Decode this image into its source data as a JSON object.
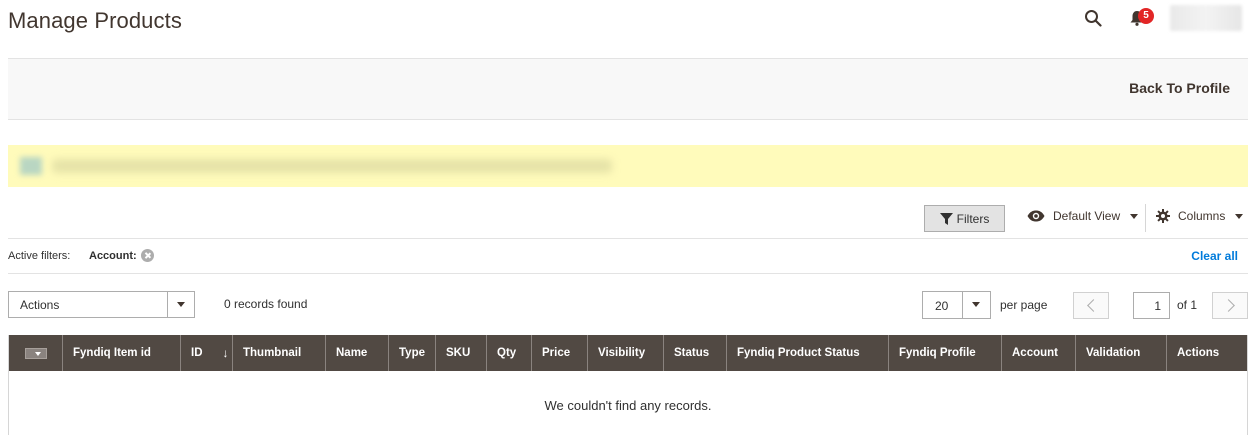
{
  "header": {
    "title": "Manage Products",
    "notifications_count": "5",
    "search_icon": "search-icon",
    "bell_icon": "bell-icon"
  },
  "actions_bar": {
    "back_label": "Back To Profile"
  },
  "toolbar": {
    "filters_label": "Filters",
    "view_label": "Default View",
    "columns_label": "Columns"
  },
  "active_filters": {
    "label": "Active filters:",
    "items": [
      "Account:"
    ],
    "clear_all": "Clear all"
  },
  "mass_actions": {
    "select_label": "Actions",
    "records_found": "0 records found"
  },
  "pagination": {
    "per_page_value": "20",
    "per_page_label": "per page",
    "current_page": "1",
    "of_label": "of 1"
  },
  "grid": {
    "columns": [
      "Fyndiq Item id",
      "ID",
      "Thumbnail",
      "Name",
      "Type",
      "SKU",
      "Qty",
      "Price",
      "Visibility",
      "Status",
      "Fyndiq Product Status",
      "Fyndiq Profile",
      "Account",
      "Validation",
      "Actions"
    ],
    "sort_indicator": "↓",
    "empty_message": "We couldn't find any records."
  },
  "colors": {
    "grid_header": "#514943",
    "notice_bg": "#fffbbb",
    "link": "#007bdb",
    "badge": "#e22626"
  }
}
